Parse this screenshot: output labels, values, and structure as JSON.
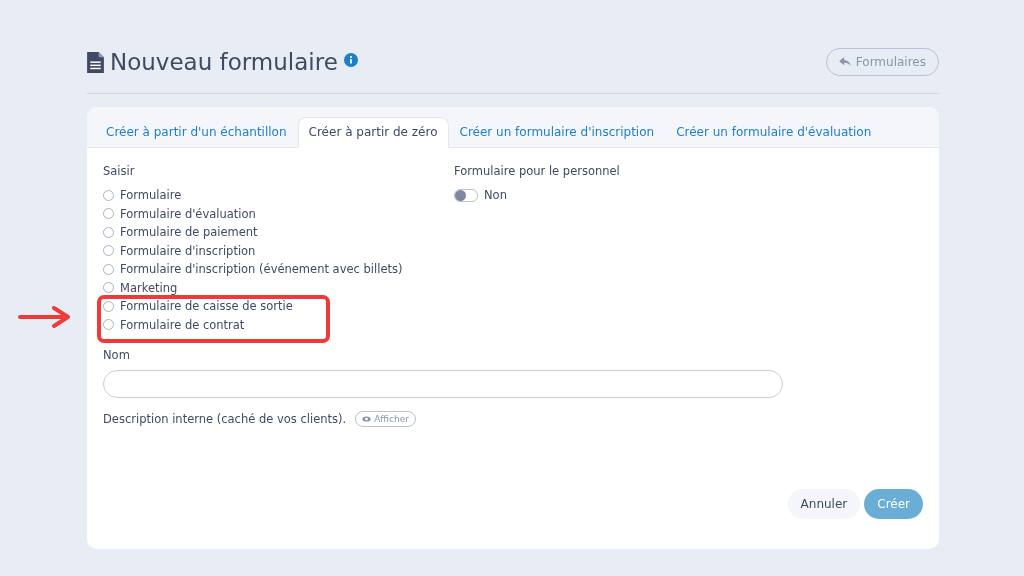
{
  "header": {
    "title": "Nouveau formulaire",
    "back_button": "Formulaires"
  },
  "tabs": [
    {
      "label": "Créer à partir d'un échantillon",
      "selected": false
    },
    {
      "label": "Créer à partir de zéro",
      "selected": true
    },
    {
      "label": "Créer un formulaire d'inscription",
      "selected": false
    },
    {
      "label": "Créer un formulaire d'évaluation",
      "selected": false
    }
  ],
  "type_group": {
    "label": "Saisir",
    "options": [
      {
        "label": "Formulaire",
        "selected": false
      },
      {
        "label": "Formulaire d'évaluation",
        "selected": false
      },
      {
        "label": "Formulaire de paiement",
        "selected": false
      },
      {
        "label": "Formulaire d'inscription",
        "selected": false
      },
      {
        "label": "Formulaire d'inscription (événement avec billets)",
        "selected": false
      },
      {
        "label": "Marketing",
        "selected": false
      },
      {
        "label": "Formulaire de caisse de sortie",
        "selected": false
      },
      {
        "label": "Formulaire de contrat",
        "selected": false
      }
    ]
  },
  "staff": {
    "label": "Formulaire pour le personnel",
    "on": false,
    "state_text": "Non"
  },
  "name_field": {
    "label": "Nom"
  },
  "description": {
    "label": "Description interne (caché de vos clients).",
    "toggle": "Afficher"
  },
  "buttons": [
    {
      "label": "Annuler",
      "kind": "secondary"
    },
    {
      "label": "Créer",
      "kind": "primary"
    }
  ]
}
